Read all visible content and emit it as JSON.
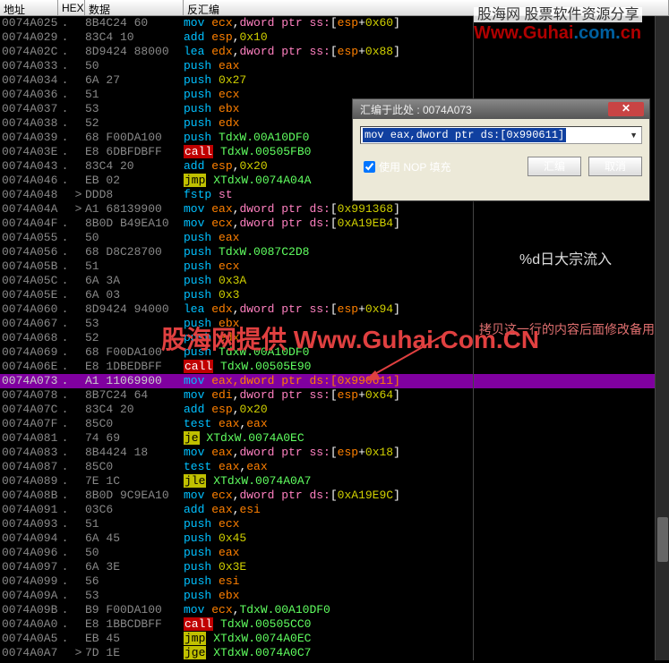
{
  "headers": {
    "addr": "地址",
    "hex": "HEX",
    "data": "数据",
    "dis": "反汇编"
  },
  "watermark_top": {
    "line1": "股海网 股票软件资源分享",
    "line2_a": "Www.",
    "line2_b": "Guhai",
    "line2_c": ".com.",
    "line2_d": "cn"
  },
  "watermark_mid": "股海网提供 Www.Guhai.Com.CN",
  "side_text": "%d日大宗流入",
  "side_text2": "拷贝这一行的内容后面修改备用",
  "dialog": {
    "title": "汇编于此处 : 0074A073",
    "input": "mov eax,dword ptr ds:[0x990611]",
    "cb_label": "使用 NOP 填充",
    "ok": "汇编",
    "cancel": "取消"
  },
  "rows": [
    {
      "addr": "0074A025",
      "mark": ".",
      "chev": "",
      "hex": "8B4C24 60",
      "dis": [
        [
          "cyan",
          "mov "
        ],
        [
          "orange",
          "ecx"
        ],
        [
          "white",
          ","
        ],
        [
          "pink",
          "dword ptr ss:"
        ],
        [
          "white",
          "["
        ],
        [
          "orange",
          "esp"
        ],
        [
          "white",
          "+"
        ],
        [
          "yel",
          "0x60"
        ],
        [
          "white",
          "]"
        ]
      ]
    },
    {
      "addr": "0074A029",
      "mark": ".",
      "chev": "",
      "hex": "83C4 10",
      "dis": [
        [
          "cyan",
          "add "
        ],
        [
          "orange",
          "esp"
        ],
        [
          "white",
          ","
        ],
        [
          "yel",
          "0x10"
        ]
      ]
    },
    {
      "addr": "0074A02C",
      "mark": ".",
      "chev": "",
      "hex": "8D9424 88000",
      "dis": [
        [
          "cyan",
          "lea "
        ],
        [
          "orange",
          "edx"
        ],
        [
          "white",
          ","
        ],
        [
          "pink",
          "dword ptr ss:"
        ],
        [
          "white",
          "["
        ],
        [
          "orange",
          "esp"
        ],
        [
          "white",
          "+"
        ],
        [
          "yel",
          "0x88"
        ],
        [
          "white",
          "]"
        ]
      ]
    },
    {
      "addr": "0074A033",
      "mark": ".",
      "chev": "",
      "hex": "50",
      "dis": [
        [
          "cyan",
          "push "
        ],
        [
          "orange",
          "eax"
        ]
      ]
    },
    {
      "addr": "0074A034",
      "mark": ".",
      "chev": "",
      "hex": "6A 27",
      "dis": [
        [
          "cyan",
          "push "
        ],
        [
          "yel",
          "0x27"
        ]
      ]
    },
    {
      "addr": "0074A036",
      "mark": ".",
      "chev": "",
      "hex": "51",
      "dis": [
        [
          "cyan",
          "push "
        ],
        [
          "orange",
          "ecx"
        ]
      ]
    },
    {
      "addr": "0074A037",
      "mark": ".",
      "chev": "",
      "hex": "53",
      "dis": [
        [
          "cyan",
          "push "
        ],
        [
          "orange",
          "ebx"
        ]
      ]
    },
    {
      "addr": "0074A038",
      "mark": ".",
      "chev": "",
      "hex": "52",
      "dis": [
        [
          "cyan",
          "push "
        ],
        [
          "orange",
          "edx"
        ]
      ]
    },
    {
      "addr": "0074A039",
      "mark": ".",
      "chev": "",
      "hex": "68 F00DA100",
      "dis": [
        [
          "cyan",
          "push "
        ],
        [
          "green",
          "TdxW.00A10DF0"
        ]
      ]
    },
    {
      "addr": "0074A03E",
      "mark": ".",
      "chev": "",
      "hex": "E8 6DBFDBFF",
      "dis": [
        [
          "invred",
          "call"
        ],
        [
          "white",
          " "
        ],
        [
          "green",
          "TdxW.00505FB0"
        ]
      ]
    },
    {
      "addr": "0074A043",
      "mark": ".",
      "chev": "",
      "hex": "83C4 20",
      "dis": [
        [
          "cyan",
          "add "
        ],
        [
          "orange",
          "esp"
        ],
        [
          "white",
          ","
        ],
        [
          "yel",
          "0x20"
        ]
      ]
    },
    {
      "addr": "0074A046",
      "mark": ".",
      "chev": "",
      "hex": "EB 02",
      "dis": [
        [
          "invyel",
          "jmp"
        ],
        [
          "white",
          " "
        ],
        [
          "green",
          "XTdxW.0074A04A"
        ]
      ]
    },
    {
      "addr": "0074A048",
      "mark": "",
      "chev": ">",
      "hex": "DDD8",
      "dis": [
        [
          "cyan",
          "fstp "
        ],
        [
          "pink",
          "st"
        ]
      ]
    },
    {
      "addr": "0074A04A",
      "mark": "",
      "chev": ">",
      "hex": "A1 68139900",
      "dis": [
        [
          "cyan",
          "mov "
        ],
        [
          "orange",
          "eax"
        ],
        [
          "white",
          ","
        ],
        [
          "pink",
          "dword ptr ds:"
        ],
        [
          "white",
          "["
        ],
        [
          "yel",
          "0x991368"
        ],
        [
          "white",
          "]"
        ]
      ]
    },
    {
      "addr": "0074A04F",
      "mark": ".",
      "chev": "",
      "hex": "8B0D B49EA10",
      "dis": [
        [
          "cyan",
          "mov "
        ],
        [
          "orange",
          "ecx"
        ],
        [
          "white",
          ","
        ],
        [
          "pink",
          "dword ptr ds:"
        ],
        [
          "white",
          "["
        ],
        [
          "yel",
          "0xA19EB4"
        ],
        [
          "white",
          "]"
        ]
      ]
    },
    {
      "addr": "0074A055",
      "mark": ".",
      "chev": "",
      "hex": "50",
      "dis": [
        [
          "cyan",
          "push "
        ],
        [
          "orange",
          "eax"
        ]
      ]
    },
    {
      "addr": "0074A056",
      "mark": ".",
      "chev": "",
      "hex": "68 D8C28700",
      "dis": [
        [
          "cyan",
          "push "
        ],
        [
          "green",
          "TdxW.0087C2D8"
        ]
      ]
    },
    {
      "addr": "0074A05B",
      "mark": ".",
      "chev": "",
      "hex": "51",
      "dis": [
        [
          "cyan",
          "push "
        ],
        [
          "orange",
          "ecx"
        ]
      ]
    },
    {
      "addr": "0074A05C",
      "mark": ".",
      "chev": "",
      "hex": "6A 3A",
      "dis": [
        [
          "cyan",
          "push "
        ],
        [
          "yel",
          "0x3A"
        ]
      ]
    },
    {
      "addr": "0074A05E",
      "mark": ".",
      "chev": "",
      "hex": "6A 03",
      "dis": [
        [
          "cyan",
          "push "
        ],
        [
          "yel",
          "0x3"
        ]
      ]
    },
    {
      "addr": "0074A060",
      "mark": ".",
      "chev": "",
      "hex": "8D9424 94000",
      "dis": [
        [
          "cyan",
          "lea "
        ],
        [
          "orange",
          "edx"
        ],
        [
          "white",
          ","
        ],
        [
          "pink",
          "dword ptr ss:"
        ],
        [
          "white",
          "["
        ],
        [
          "orange",
          "esp"
        ],
        [
          "white",
          "+"
        ],
        [
          "yel",
          "0x94"
        ],
        [
          "white",
          "]"
        ]
      ]
    },
    {
      "addr": "0074A067",
      "mark": ".",
      "chev": "",
      "hex": "53",
      "dis": [
        [
          "cyan",
          "push "
        ],
        [
          "orange",
          "ebx"
        ]
      ]
    },
    {
      "addr": "0074A068",
      "mark": ".",
      "chev": "",
      "hex": "52",
      "dis": [
        [
          "cyan",
          "push "
        ],
        [
          "orange",
          "edx"
        ]
      ]
    },
    {
      "addr": "0074A069",
      "mark": ".",
      "chev": "",
      "hex": "68 F00DA100",
      "dis": [
        [
          "cyan",
          "push "
        ],
        [
          "green",
          "TdxW.00A10DF0"
        ]
      ]
    },
    {
      "addr": "0074A06E",
      "mark": ".",
      "chev": "",
      "hex": "E8 1DBEDBFF",
      "dis": [
        [
          "invred",
          "call"
        ],
        [
          "white",
          " "
        ],
        [
          "green",
          "TdxW.00505E90"
        ]
      ]
    },
    {
      "addr": "0074A073",
      "mark": ".",
      "chev": "",
      "hex": "A1 11069900",
      "hl": true,
      "dis": [
        [
          "cyan",
          "mov "
        ],
        [
          "orange",
          "eax"
        ],
        [
          "orange",
          ","
        ],
        [
          "orange",
          "dword ptr ds:"
        ],
        [
          "orange",
          "["
        ],
        [
          "orange",
          "0x990611"
        ],
        [
          "orange",
          "]"
        ]
      ]
    },
    {
      "addr": "0074A078",
      "mark": ".",
      "chev": "",
      "hex": "8B7C24 64",
      "dis": [
        [
          "cyan",
          "mov "
        ],
        [
          "orange",
          "edi"
        ],
        [
          "white",
          ","
        ],
        [
          "pink",
          "dword ptr ss:"
        ],
        [
          "white",
          "["
        ],
        [
          "orange",
          "esp"
        ],
        [
          "white",
          "+"
        ],
        [
          "yel",
          "0x64"
        ],
        [
          "white",
          "]"
        ]
      ]
    },
    {
      "addr": "0074A07C",
      "mark": ".",
      "chev": "",
      "hex": "83C4 20",
      "dis": [
        [
          "cyan",
          "add "
        ],
        [
          "orange",
          "esp"
        ],
        [
          "white",
          ","
        ],
        [
          "yel",
          "0x20"
        ]
      ]
    },
    {
      "addr": "0074A07F",
      "mark": ".",
      "chev": "",
      "hex": "85C0",
      "dis": [
        [
          "cyan",
          "test "
        ],
        [
          "orange",
          "eax"
        ],
        [
          "white",
          ","
        ],
        [
          "orange",
          "eax"
        ]
      ]
    },
    {
      "addr": "0074A081",
      "mark": ".",
      "chev": "",
      "hex": "74 69",
      "dis": [
        [
          "invyel",
          "je"
        ],
        [
          "white",
          " "
        ],
        [
          "green",
          "XTdxW.0074A0EC"
        ]
      ]
    },
    {
      "addr": "0074A083",
      "mark": ".",
      "chev": "",
      "hex": "8B4424 18",
      "dis": [
        [
          "cyan",
          "mov "
        ],
        [
          "orange",
          "eax"
        ],
        [
          "white",
          ","
        ],
        [
          "pink",
          "dword ptr ss:"
        ],
        [
          "white",
          "["
        ],
        [
          "orange",
          "esp"
        ],
        [
          "white",
          "+"
        ],
        [
          "yel",
          "0x18"
        ],
        [
          "white",
          "]"
        ]
      ]
    },
    {
      "addr": "0074A087",
      "mark": ".",
      "chev": "",
      "hex": "85C0",
      "dis": [
        [
          "cyan",
          "test "
        ],
        [
          "orange",
          "eax"
        ],
        [
          "white",
          ","
        ],
        [
          "orange",
          "eax"
        ]
      ]
    },
    {
      "addr": "0074A089",
      "mark": ".",
      "chev": "",
      "hex": "7E 1C",
      "dis": [
        [
          "invyel",
          "jle"
        ],
        [
          "white",
          " "
        ],
        [
          "green",
          "XTdxW.0074A0A7"
        ]
      ]
    },
    {
      "addr": "0074A08B",
      "mark": ".",
      "chev": "",
      "hex": "8B0D 9C9EA10",
      "dis": [
        [
          "cyan",
          "mov "
        ],
        [
          "orange",
          "ecx"
        ],
        [
          "white",
          ","
        ],
        [
          "pink",
          "dword ptr ds:"
        ],
        [
          "white",
          "["
        ],
        [
          "yel",
          "0xA19E9C"
        ],
        [
          "white",
          "]"
        ]
      ]
    },
    {
      "addr": "0074A091",
      "mark": ".",
      "chev": "",
      "hex": "03C6",
      "dis": [
        [
          "cyan",
          "add "
        ],
        [
          "orange",
          "eax"
        ],
        [
          "white",
          ","
        ],
        [
          "orange",
          "esi"
        ]
      ]
    },
    {
      "addr": "0074A093",
      "mark": ".",
      "chev": "",
      "hex": "51",
      "dis": [
        [
          "cyan",
          "push "
        ],
        [
          "orange",
          "ecx"
        ]
      ]
    },
    {
      "addr": "0074A094",
      "mark": ".",
      "chev": "",
      "hex": "6A 45",
      "dis": [
        [
          "cyan",
          "push "
        ],
        [
          "yel",
          "0x45"
        ]
      ]
    },
    {
      "addr": "0074A096",
      "mark": ".",
      "chev": "",
      "hex": "50",
      "dis": [
        [
          "cyan",
          "push "
        ],
        [
          "orange",
          "eax"
        ]
      ]
    },
    {
      "addr": "0074A097",
      "mark": ".",
      "chev": "",
      "hex": "6A 3E",
      "dis": [
        [
          "cyan",
          "push "
        ],
        [
          "yel",
          "0x3E"
        ]
      ]
    },
    {
      "addr": "0074A099",
      "mark": ".",
      "chev": "",
      "hex": "56",
      "dis": [
        [
          "cyan",
          "push "
        ],
        [
          "orange",
          "esi"
        ]
      ]
    },
    {
      "addr": "0074A09A",
      "mark": ".",
      "chev": "",
      "hex": "53",
      "dis": [
        [
          "cyan",
          "push "
        ],
        [
          "orange",
          "ebx"
        ]
      ]
    },
    {
      "addr": "0074A09B",
      "mark": ".",
      "chev": "",
      "hex": "B9 F00DA100",
      "dis": [
        [
          "cyan",
          "mov "
        ],
        [
          "orange",
          "ecx"
        ],
        [
          "white",
          ","
        ],
        [
          "green",
          "TdxW.00A10DF0"
        ]
      ]
    },
    {
      "addr": "0074A0A0",
      "mark": ".",
      "chev": "",
      "hex": "E8 1BBCDBFF",
      "dis": [
        [
          "invred",
          "call"
        ],
        [
          "white",
          " "
        ],
        [
          "green",
          "TdxW.00505CC0"
        ]
      ]
    },
    {
      "addr": "0074A0A5",
      "mark": ".",
      "chev": "",
      "hex": "EB 45",
      "dis": [
        [
          "invyel",
          "jmp"
        ],
        [
          "white",
          " "
        ],
        [
          "green",
          "XTdxW.0074A0EC"
        ]
      ]
    },
    {
      "addr": "0074A0A7",
      "mark": "",
      "chev": ">",
      "hex": "7D 1E",
      "dis": [
        [
          "invyel",
          "jge"
        ],
        [
          "white",
          " "
        ],
        [
          "green",
          "XTdxW.0074A0C7"
        ]
      ]
    }
  ]
}
